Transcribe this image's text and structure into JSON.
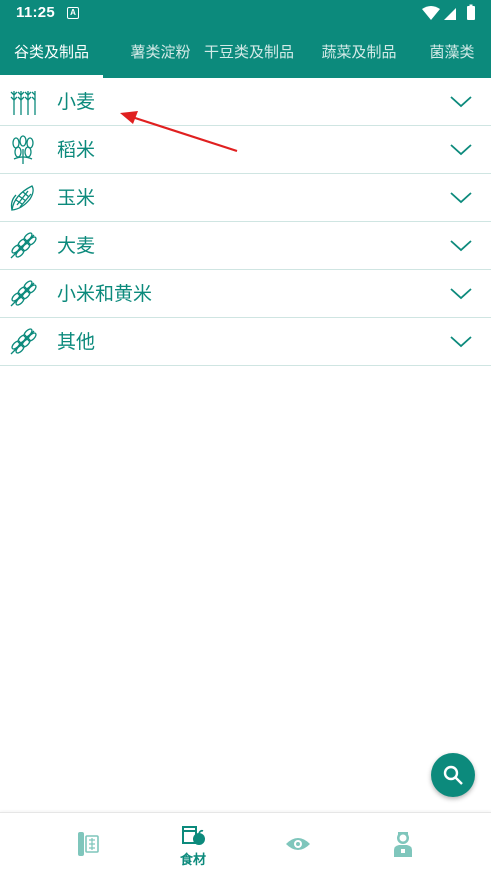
{
  "status_bar": {
    "time": "11:25",
    "notification_badge": "A",
    "icons": [
      "wifi-icon",
      "signal-icon",
      "battery-icon"
    ]
  },
  "tabs": [
    {
      "label": "谷类及制品",
      "active": true
    },
    {
      "label": "薯类淀粉",
      "active": false
    },
    {
      "label": "干豆类及制品",
      "active": false
    },
    {
      "label": "蔬菜及制品",
      "active": false
    },
    {
      "label": "菌藻类",
      "active": false
    }
  ],
  "categories": [
    {
      "label": "小麦",
      "icon": "wheat-icon"
    },
    {
      "label": "稻米",
      "icon": "rice-icon"
    },
    {
      "label": "玉米",
      "icon": "corn-icon"
    },
    {
      "label": "大麦",
      "icon": "barley-icon"
    },
    {
      "label": "小米和黄米",
      "icon": "millet-icon"
    },
    {
      "label": "其他",
      "icon": "grain-other-icon"
    }
  ],
  "fab": {
    "icon": "search-icon"
  },
  "bottom_nav": [
    {
      "icon": "ruler-icon",
      "label": "",
      "active": false
    },
    {
      "icon": "food-basket-icon",
      "label": "食材",
      "active": true
    },
    {
      "icon": "eye-icon",
      "label": "",
      "active": false
    },
    {
      "icon": "doctor-icon",
      "label": "",
      "active": false
    }
  ],
  "colors": {
    "primary": "#0c8a7c",
    "divider": "#cfe5e2",
    "annotation_arrow": "#e02020"
  }
}
